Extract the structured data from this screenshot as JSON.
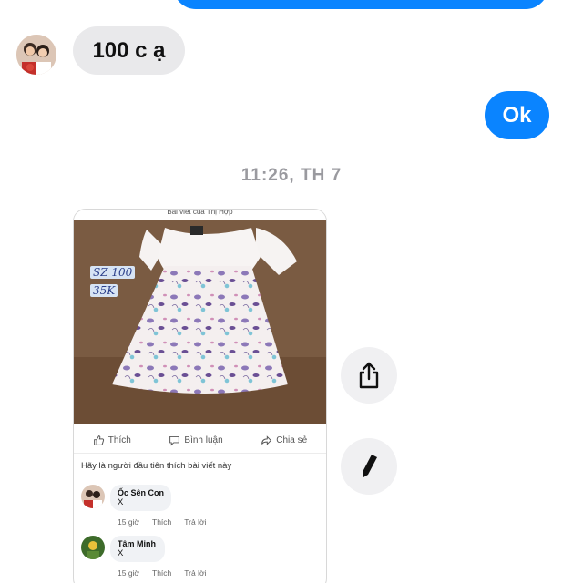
{
  "messages": {
    "incoming_text": "100 c ạ",
    "outgoing_text": "Ok",
    "timestamp": "11:26, TH 7"
  },
  "shared_post": {
    "header_text": "Bài viết của Thị Hợp",
    "photo_tags": {
      "size": "SZ 100",
      "price": "35K"
    },
    "actions": {
      "like": "Thích",
      "comment": "Bình luận",
      "share": "Chia sẻ"
    },
    "first_like_prompt": "Hãy là người đầu tiên thích bài viết này",
    "comments": [
      {
        "name": "Ốc Sên Con",
        "text": "X",
        "time": "15 giờ",
        "like": "Thích",
        "reply": "Trả lời"
      },
      {
        "name": "Tâm Minh",
        "text": "X",
        "time": "15 giờ",
        "like": "Thích",
        "reply": "Trả lời"
      }
    ]
  },
  "side_buttons": {
    "share_icon": "share-icon",
    "edit_icon": "pencil-icon"
  },
  "colors": {
    "accent": "#0a84ff",
    "incoming_bubble": "#e9e9eb",
    "timestamp": "#9a9a9f"
  }
}
